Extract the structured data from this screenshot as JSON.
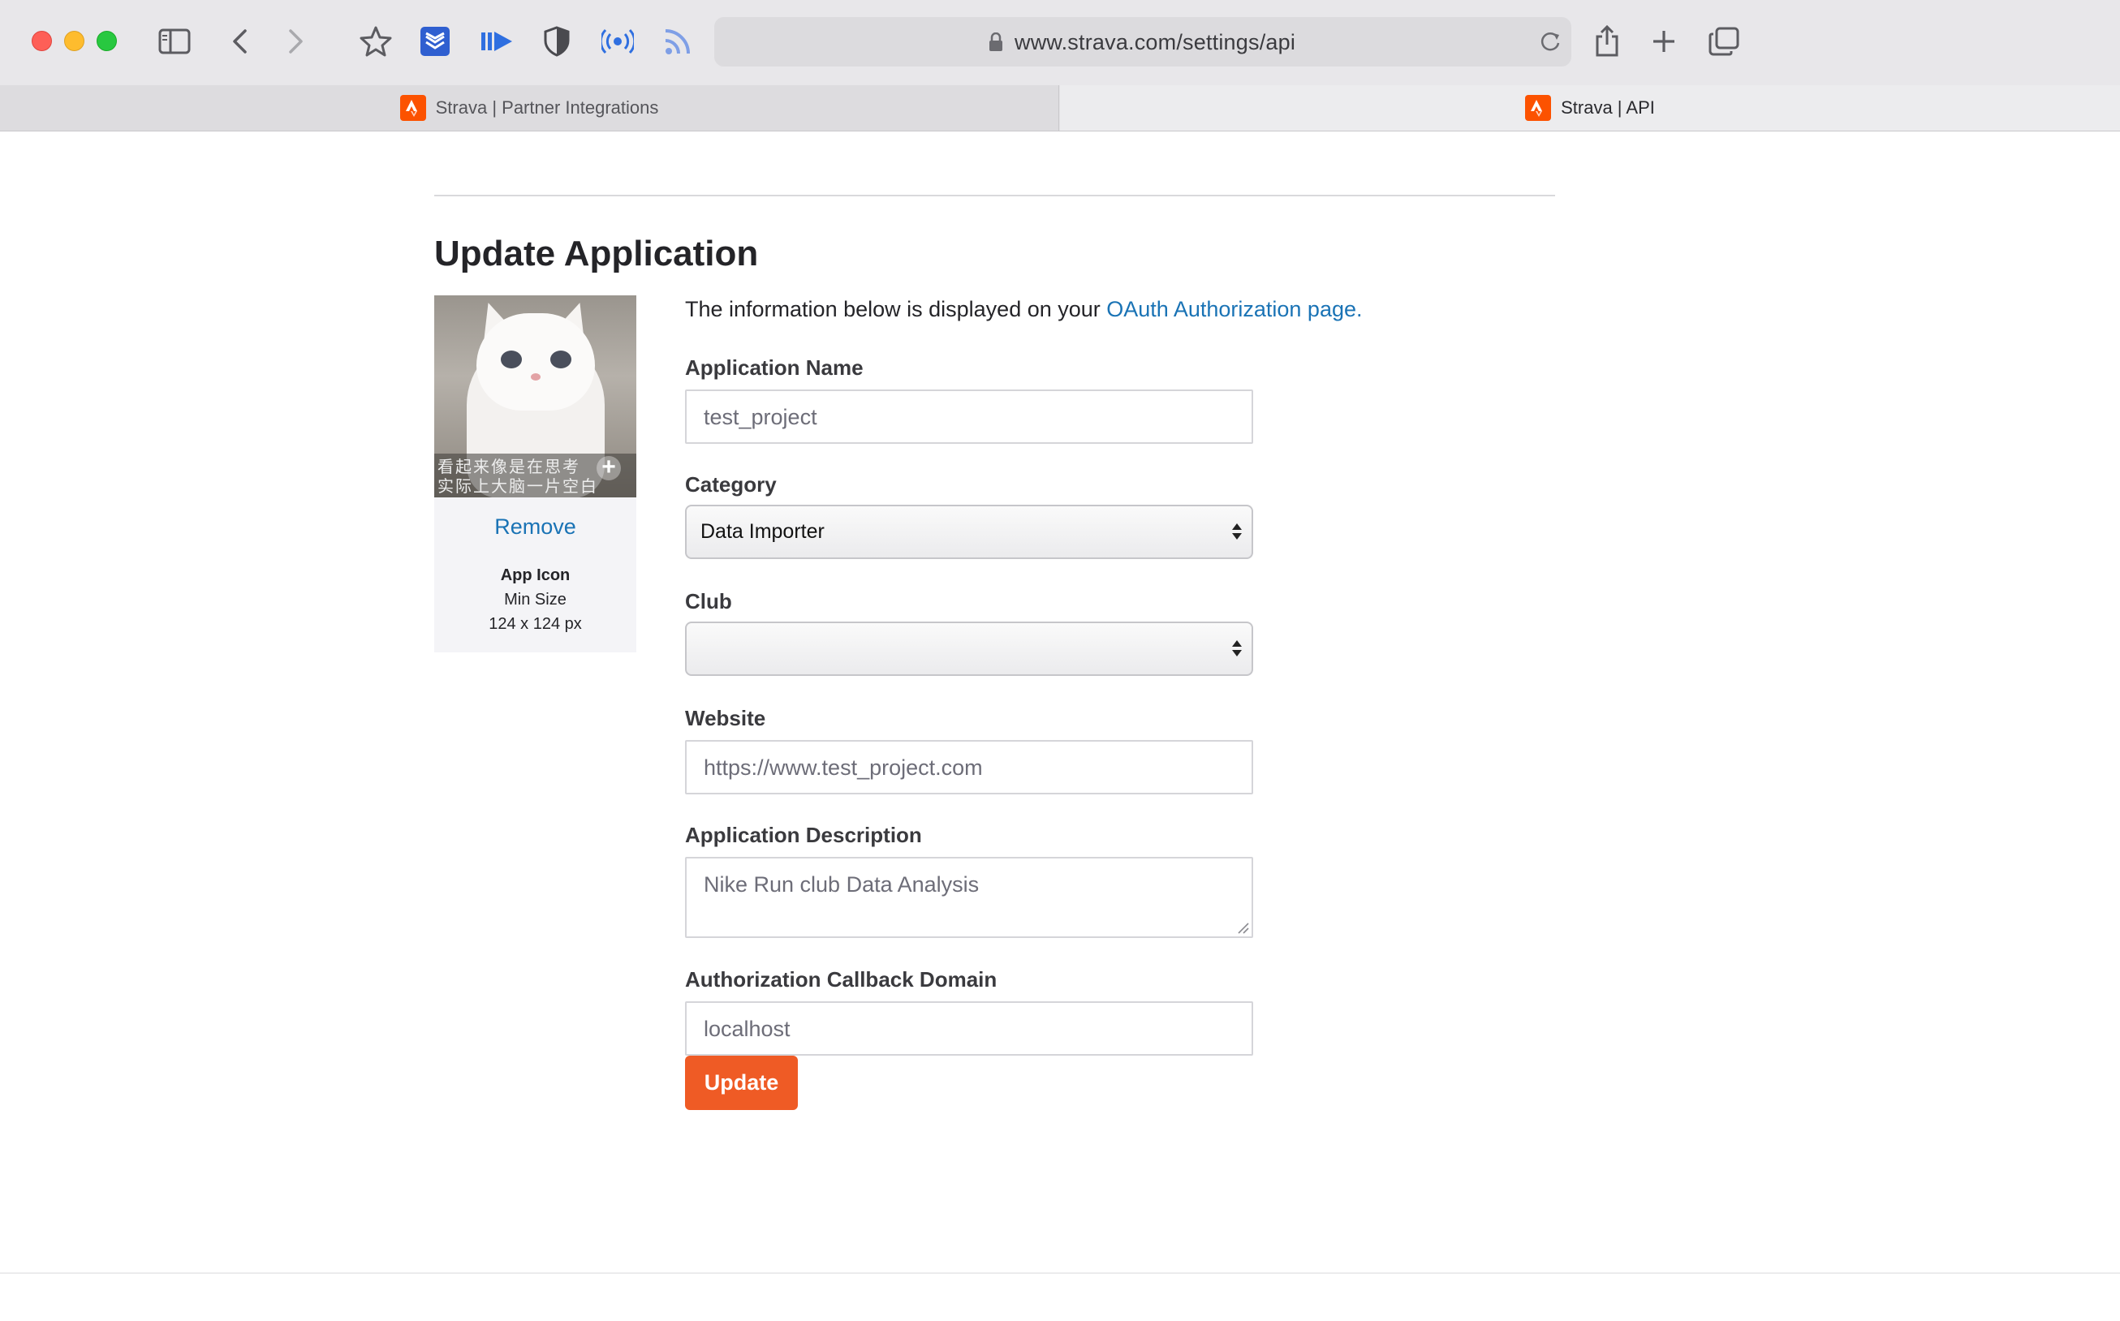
{
  "browser": {
    "url": "www.strava.com/settings/api",
    "tabs": [
      {
        "title": "Strava | Partner Integrations",
        "active": false
      },
      {
        "title": "Strava | API",
        "active": true
      }
    ],
    "toolbar_icons": [
      "sidebar-icon",
      "back-icon",
      "forward-icon",
      "bookmark-star-icon",
      "stack-extension-icon",
      "play-extension-icon",
      "shield-extension-icon",
      "radio-extension-icon",
      "rss-extension-icon",
      "share-icon",
      "new-tab-icon",
      "tab-overview-icon"
    ]
  },
  "page": {
    "title": "Update Application",
    "intro_text": "The information below is displayed on your ",
    "intro_link": "OAuth Authorization page.",
    "icon_card": {
      "caption_line1": "看起来像是在思考",
      "caption_line2": "实际上大脑一片空白",
      "remove_label": "Remove",
      "label": "App Icon",
      "min_size_label": "Min Size",
      "dimensions": "124 x 124 px"
    },
    "form": {
      "app_name_label": "Application Name",
      "app_name_value": "test_project",
      "category_label": "Category",
      "category_value": "Data Importer",
      "club_label": "Club",
      "club_value": "",
      "website_label": "Website",
      "website_value": "https://www.test_project.com",
      "description_label": "Application Description",
      "description_value": "Nike Run club Data Analysis",
      "callback_label": "Authorization Callback Domain",
      "callback_value": "localhost",
      "submit_label": "Update"
    }
  },
  "colors": {
    "brand": "#fc5200",
    "button": "#ef5b25",
    "link": "#1a73b5"
  }
}
